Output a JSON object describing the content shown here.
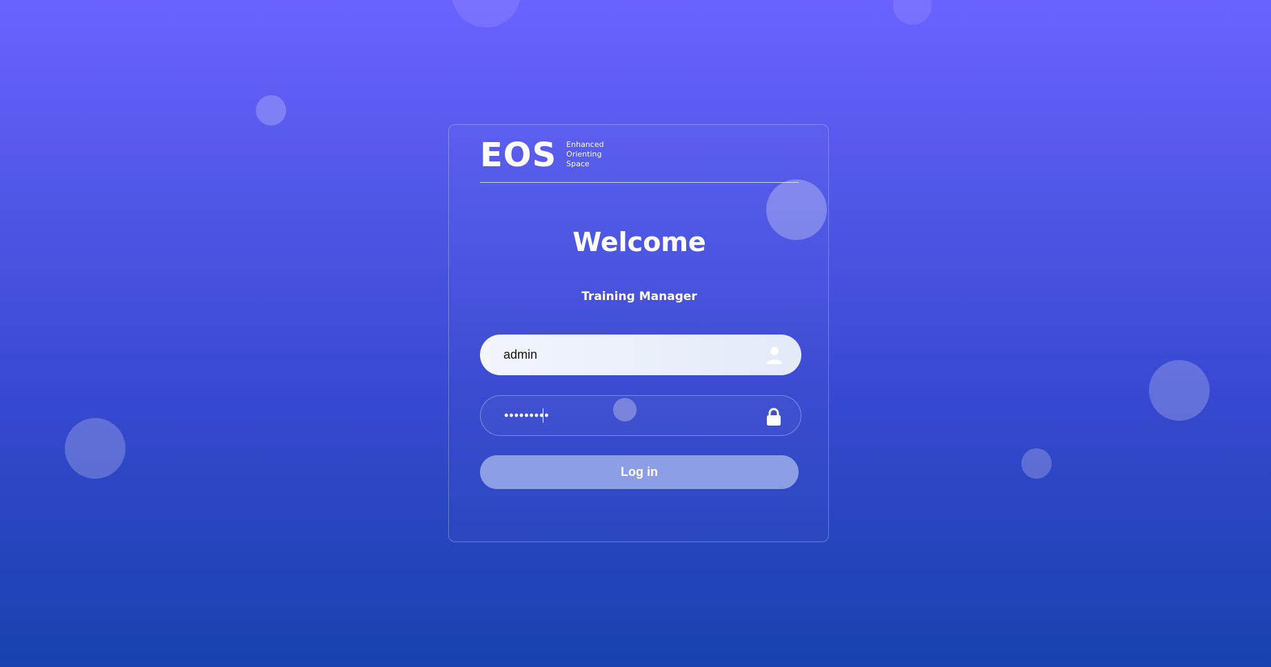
{
  "brand": {
    "logo": "EOS",
    "tagline": [
      "Enhanced",
      "Orienting",
      "Space"
    ]
  },
  "welcome": {
    "title": "Welcome",
    "subtitle": "Training Manager"
  },
  "form": {
    "username": {
      "value": "admin",
      "icon": "user-icon"
    },
    "password": {
      "value": "•••••••••",
      "icon": "lock-icon"
    },
    "login_label": "Log in"
  },
  "colors": {
    "background_top": "#6b62ff",
    "background_bottom": "#1742ad",
    "text": "#ffffff"
  }
}
